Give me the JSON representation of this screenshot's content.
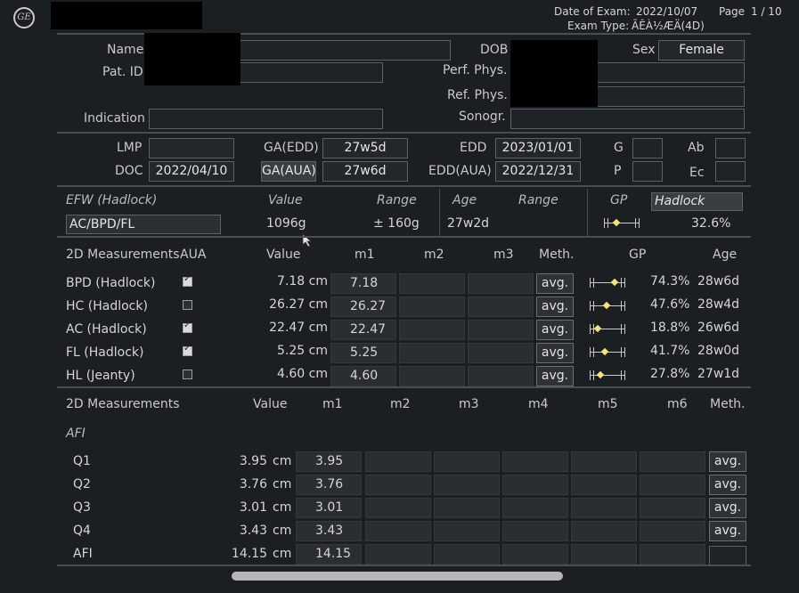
{
  "header": {
    "date_label": "Date of Exam:",
    "date_value": "2022/10/07",
    "page_label": "Page",
    "page_value": "1 / 10",
    "exam_type_label": "Exam Type:",
    "exam_type_value": "ÃÊÀ½ÆÄ(4D)"
  },
  "patient": {
    "name_label": "Name",
    "patid_label": "Pat. ID",
    "indication_label": "Indication",
    "dob_label": "DOB",
    "sex_label": "Sex",
    "sex_value": "Female",
    "perf_label": "Perf. Phys.",
    "ref_label": "Ref. Phys.",
    "sonogr_label": "Sonogr."
  },
  "dating": {
    "lmp_label": "LMP",
    "lmp_value": "",
    "doc_label": "DOC",
    "doc_value": "2022/04/10",
    "gaedd_label": "GA(EDD)",
    "gaedd_value": "27w5d",
    "gaaua_label": "GA(AUA)",
    "gaaua_value": "27w6d",
    "edd_label": "EDD",
    "edd_value": "2023/01/01",
    "eddaua_label": "EDD(AUA)",
    "eddaua_value": "2022/12/31",
    "g_label": "G",
    "p_label": "P",
    "ab_label": "Ab",
    "ec_label": "Ec"
  },
  "efw": {
    "title": "EFW (Hadlock)",
    "value_header": "Value",
    "range_header": "Range",
    "age_header": "Age",
    "range2_header": "Range",
    "gp_header": "GP",
    "gp_method": "Hadlock",
    "formula": "AC/BPD/FL",
    "value": "1096g",
    "range": "± 160g",
    "age": "27w2d",
    "gp_value": "32.6%",
    "gp_pct": 0.326
  },
  "meas1": {
    "headers": [
      "2D Measurements",
      "AUA",
      "Value",
      "m1",
      "m2",
      "m3",
      "Meth.",
      "GP",
      "Age"
    ],
    "rows": [
      {
        "name": "BPD (Hadlock)",
        "aua": true,
        "value": "7.18 cm",
        "m1": "7.18",
        "meth": "avg.",
        "gp": "74.3%",
        "age": "28w6d",
        "gp_pct": 0.743
      },
      {
        "name": "HC (Hadlock)",
        "aua": false,
        "value": "26.27 cm",
        "m1": "26.27",
        "meth": "avg.",
        "gp": "47.6%",
        "age": "28w4d",
        "gp_pct": 0.476
      },
      {
        "name": "AC (Hadlock)",
        "aua": true,
        "value": "22.47 cm",
        "m1": "22.47",
        "meth": "avg.",
        "gp": "18.8%",
        "age": "26w6d",
        "gp_pct": 0.188
      },
      {
        "name": "FL (Hadlock)",
        "aua": true,
        "value": "5.25 cm",
        "m1": "5.25",
        "meth": "avg.",
        "gp": "41.7%",
        "age": "28w0d",
        "gp_pct": 0.417
      },
      {
        "name": "HL (Jeanty)",
        "aua": false,
        "value": "4.60 cm",
        "m1": "4.60",
        "meth": "avg.",
        "gp": "27.8%",
        "age": "27w1d",
        "gp_pct": 0.278
      }
    ]
  },
  "meas2": {
    "headers": [
      "2D Measurements",
      "Value",
      "m1",
      "m2",
      "m3",
      "m4",
      "m5",
      "m6",
      "Meth."
    ],
    "section": "AFI",
    "rows": [
      {
        "name": "Q1",
        "value": "3.95",
        "unit": "cm",
        "m1": "3.95",
        "meth": "avg."
      },
      {
        "name": "Q2",
        "value": "3.76",
        "unit": "cm",
        "m1": "3.76",
        "meth": "avg."
      },
      {
        "name": "Q3",
        "value": "3.01",
        "unit": "cm",
        "m1": "3.01",
        "meth": "avg."
      },
      {
        "name": "Q4",
        "value": "3.43",
        "unit": "cm",
        "m1": "3.43",
        "meth": "avg."
      },
      {
        "name": "AFI",
        "value": "14.15",
        "unit": "cm",
        "m1": "14.15",
        "meth": ""
      }
    ]
  }
}
